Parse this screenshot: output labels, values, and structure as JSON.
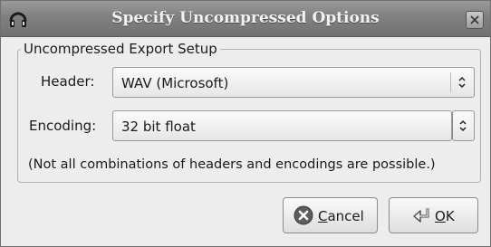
{
  "window": {
    "title": "Specify Uncompressed Options"
  },
  "group": {
    "legend": "Uncompressed Export Setup"
  },
  "header": {
    "label": "Header:",
    "value": "WAV (Microsoft)"
  },
  "encoding": {
    "label": "Encoding:",
    "value": "32 bit float"
  },
  "note": "(Not all combinations of headers and encodings are possible.)",
  "buttons": {
    "cancel": {
      "mnemonic": "C",
      "rest": "ancel"
    },
    "ok": {
      "mnemonic": "O",
      "rest": "K"
    }
  },
  "icons": {
    "title": "headphones-icon",
    "close": "close-icon",
    "cancel": "cancel-icon",
    "ok": "ok-arrow-icon",
    "combo": "up-down-chevron-icon"
  }
}
